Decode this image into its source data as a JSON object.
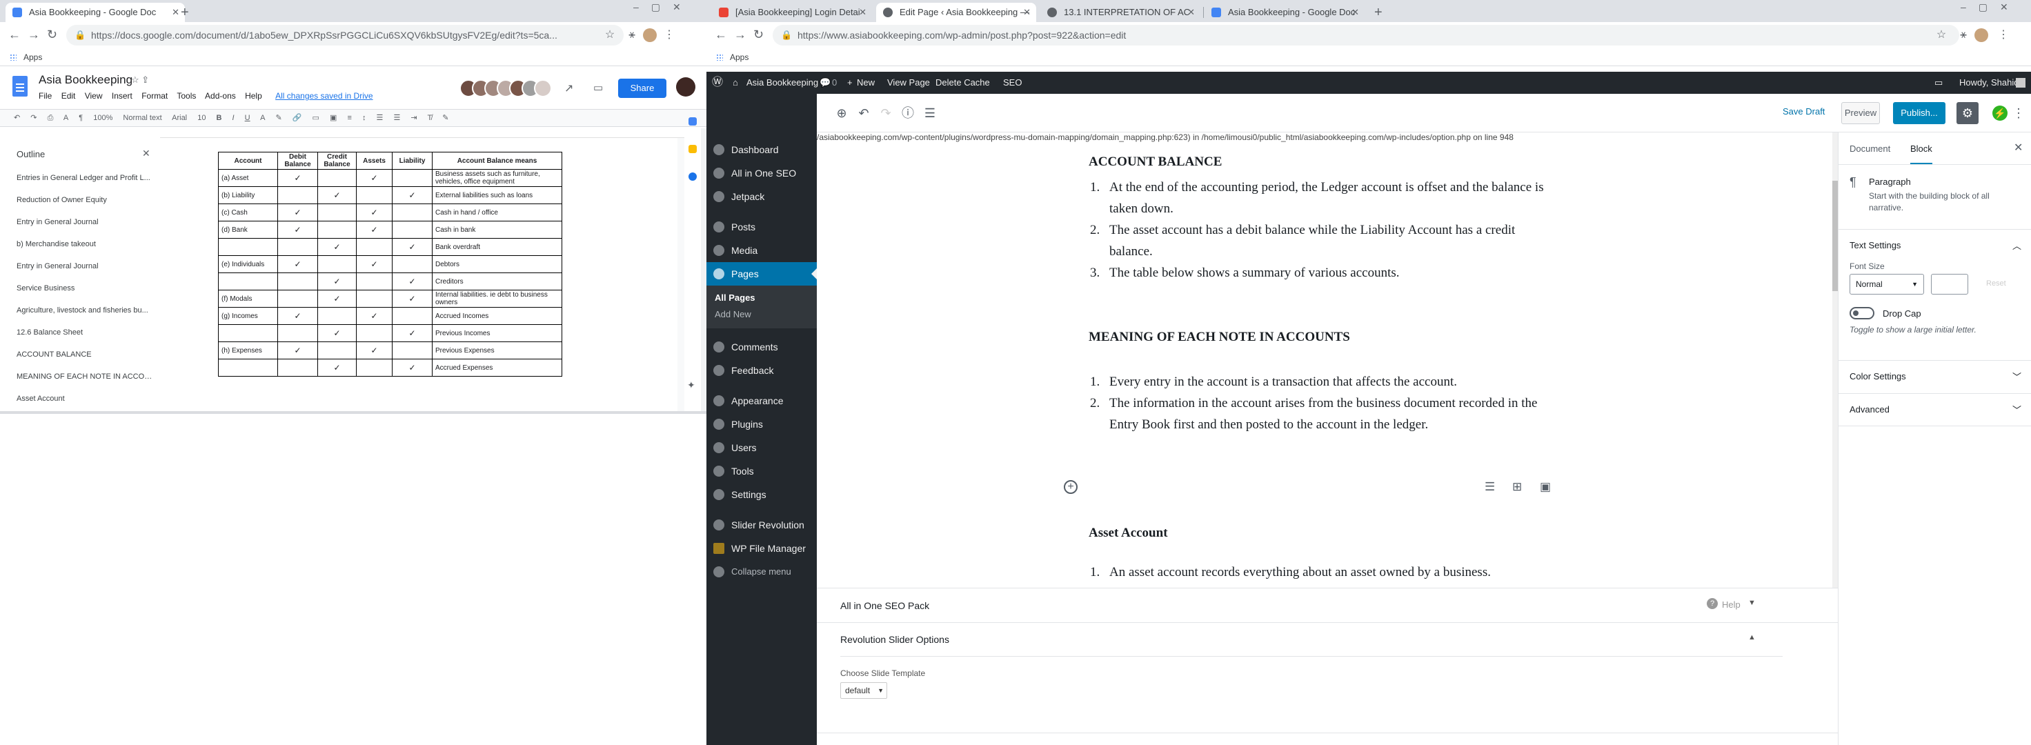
{
  "left_window": {
    "tab": {
      "title": "Asia Bookkeeping - Google Doc"
    },
    "url": "https://docs.google.com/document/d/1abo5ew_DPXRpSsrPGGCLiCu6SXQV6kbSUtgysFV2Eg/edit?ts=5ca...",
    "bookmarks_label": "Apps",
    "doc_title": "Asia Bookkeeping",
    "menu": [
      "File",
      "Edit",
      "View",
      "Insert",
      "Format",
      "Tools",
      "Add-ons",
      "Help"
    ],
    "saved_status": "All changes saved in Drive",
    "share_label": "Share",
    "toolbar": {
      "zoom": "100%",
      "style": "Normal text",
      "font": "Arial",
      "size": "10"
    },
    "outline": {
      "title": "Outline",
      "items": [
        "Entries in General Ledger and Profit L...",
        "Reduction of Owner Equity",
        "Entry in General Journal",
        "b) Merchandise takeout",
        "Entry in General Journal",
        "Service Business",
        "Agriculture, livestock and fisheries bu...",
        "12.6 Balance Sheet",
        "ACCOUNT BALANCE",
        "MEANING OF EACH NOTE IN ACCOU...",
        "Asset Account"
      ]
    },
    "table": {
      "headers": [
        "Account",
        "Debit Balance",
        "Credit Balance",
        "Assets",
        "Liability",
        "Account Balance means"
      ],
      "rows": [
        [
          "(a) Asset",
          "✓",
          "",
          "✓",
          "",
          "Business assets such as furniture, vehicles, office equipment"
        ],
        [
          "(b) Liability",
          "",
          "✓",
          "",
          "✓",
          "External liabilities such as loans"
        ],
        [
          "(c) Cash",
          "✓",
          "",
          "✓",
          "",
          "Cash in hand / office"
        ],
        [
          "(d) Bank",
          "✓",
          "",
          "✓",
          "",
          "Cash in bank"
        ],
        [
          "",
          "",
          "✓",
          "",
          "✓",
          "Bank overdraft"
        ],
        [
          "(e) Individuals",
          "✓",
          "",
          "✓",
          "",
          "Debtors"
        ],
        [
          "",
          "",
          "✓",
          "",
          "✓",
          "Creditors"
        ],
        [
          "(f) Modals",
          "",
          "✓",
          "",
          "✓",
          "Internal liabilities. ie debt to business owners"
        ],
        [
          "(g) Incomes",
          "✓",
          "",
          "✓",
          "",
          "Accrued Incomes"
        ],
        [
          "",
          "",
          "✓",
          "",
          "✓",
          "Previous Incomes"
        ],
        [
          "(h) Expenses",
          "✓",
          "",
          "✓",
          "",
          "Previous Expenses"
        ],
        [
          "",
          "",
          "✓",
          "",
          "✓",
          "Accrued Expenses"
        ]
      ]
    }
  },
  "right_window": {
    "tabs": [
      {
        "title": "[Asia Bookkeeping] Login Detai"
      },
      {
        "title": "Edit Page ‹ Asia Bookkeeping —"
      },
      {
        "title": "13.1 INTERPRETATION OF AC"
      },
      {
        "title": "Asia Bookkeeping - Google Doc"
      }
    ],
    "url": "https://www.asiabookkeeping.com/wp-admin/post.php?post=922&action=edit",
    "bookmarks_label": "Apps",
    "adminbar": {
      "site": "Asia Bookkeeping",
      "comments": "0",
      "new": "New",
      "view": "View Page",
      "cache": "Delete Cache",
      "seo": "SEO",
      "howdy": "Howdy, Shahida"
    },
    "sidebar_menu": [
      "Dashboard",
      "All in One SEO",
      "Jetpack",
      "Posts",
      "Media",
      "Pages",
      "Comments",
      "Feedback",
      "Appearance",
      "Plugins",
      "Users",
      "Tools",
      "Settings",
      "Slider Revolution",
      "WP File Manager",
      "Collapse menu"
    ],
    "pages_sub": [
      "All Pages",
      "Add New"
    ],
    "editor_toolbar": {
      "save_draft": "Save Draft",
      "preview": "Preview",
      "publish": "Publish..."
    },
    "warning": "/asiabookkeeping.com/wp-content/plugins/wordpress-mu-domain-mapping/domain_mapping.php:623) in /home/limousi0/public_html/asiabookkeeping.com/wp-includes/option.php on line 948",
    "content": {
      "h1": "ACCOUNT BALANCE",
      "list1": [
        "At the end of the accounting period, the Ledger account is offset and the balance is taken down.",
        "The asset account has a debit balance while the Liability Account has a credit balance.",
        "The table below shows a summary of various accounts."
      ],
      "h2": "MEANING OF EACH NOTE IN ACCOUNTS",
      "list2": [
        "Every entry in the account is a transaction that affects the account.",
        "The information in the account arises from the business document recorded in the Entry  Book first and then posted to the account in the ledger."
      ],
      "h3": "Asset Account",
      "list3": [
        "An asset account records everything about an asset owned by a business."
      ]
    },
    "metaboxes": {
      "seo": "All in One SEO Pack",
      "help": "Help",
      "slider": "Revolution Slider Options",
      "template_label": "Choose Slide Template",
      "template_value": "default"
    },
    "block_sidebar": {
      "tab_document": "Document",
      "tab_block": "Block",
      "block_name": "Paragraph",
      "block_desc": "Start with the building block of all narrative.",
      "text_settings": "Text Settings",
      "font_size_label": "Font Size",
      "font_size_value": "Normal",
      "reset": "Reset",
      "drop_cap": "Drop Cap",
      "drop_cap_help": "Toggle to show a large initial letter.",
      "color_settings": "Color Settings",
      "advanced": "Advanced"
    }
  }
}
